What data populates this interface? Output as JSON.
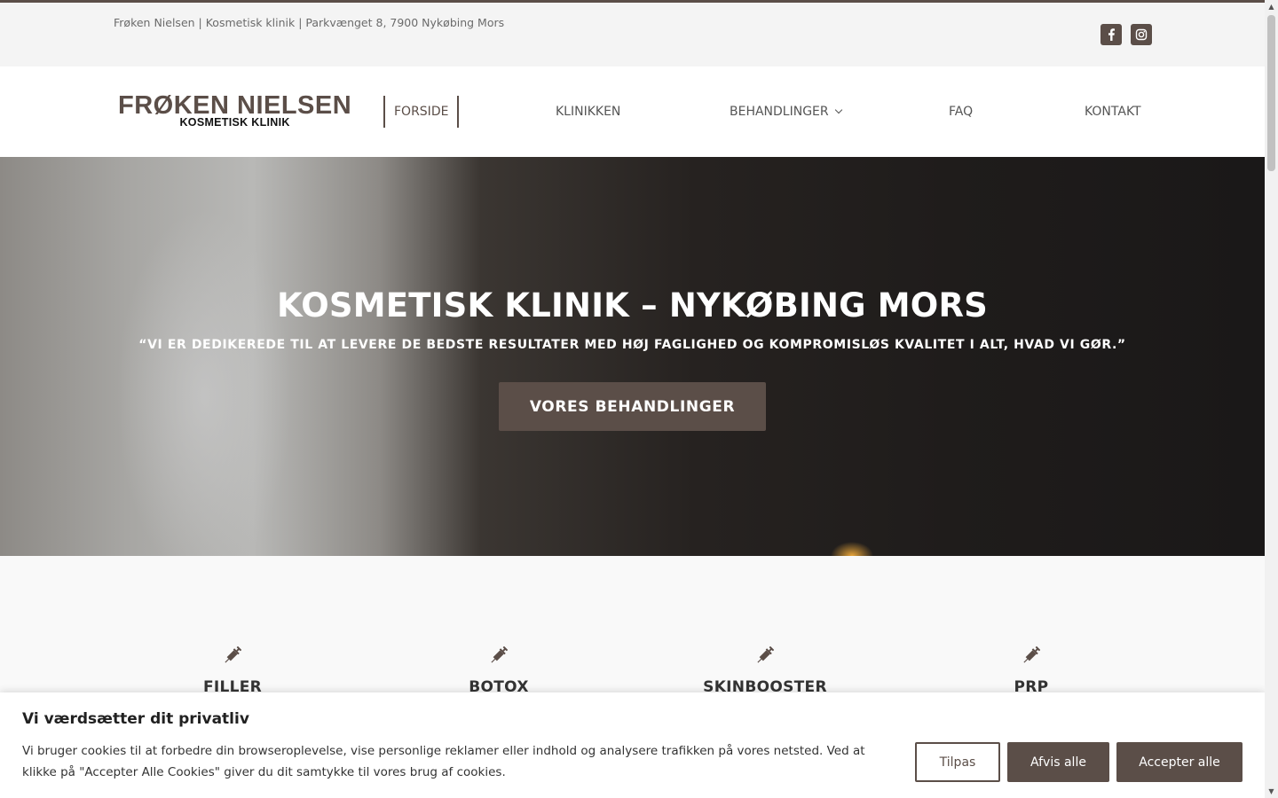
{
  "topbar": {
    "text": "Frøken Nielsen | Kosmetisk klinik | Parkvænget 8, 7900 Nykøbing Mors",
    "social": [
      {
        "name": "facebook-icon",
        "glyph": "f"
      },
      {
        "name": "instagram-icon",
        "glyph": "◎"
      }
    ]
  },
  "logo": {
    "main": "FRØKEN NIELSEN",
    "sub": "KOSMETISK KLINIK"
  },
  "nav": {
    "items": [
      {
        "label": "FORSIDE",
        "active": true
      },
      {
        "label": "KLINIKKEN"
      },
      {
        "label": "BEHANDLINGER",
        "dropdown": true
      },
      {
        "label": "FAQ"
      },
      {
        "label": "KONTAKT"
      }
    ]
  },
  "hero": {
    "title": "KOSMETISK KLINIK – NYKØBING MORS",
    "quote": "“VI ER DEDIKEREDE TIL AT LEVERE DE BEDSTE RESULTATER MED HØJ FAGLIGHED OG KOMPROMISLØS KVALITET I ALT, HVAD VI GØR.”",
    "button": "VORES BEHANDLINGER"
  },
  "treatments": [
    {
      "label": "FILLER",
      "icon": "syringe-icon"
    },
    {
      "label": "BOTOX",
      "icon": "syringe-icon"
    },
    {
      "label": "SKINBOOSTER",
      "icon": "syringe-icon"
    },
    {
      "label": "PRP",
      "icon": "syringe-icon"
    }
  ],
  "cookie": {
    "title": "Vi værdsætter dit privatliv",
    "text": "Vi bruger cookies til at forbedre din browseroplevelse, vise personlige reklamer eller indhold og analysere trafikken på vores netsted. Ved at klikke på \"Accepter Alle Cookies\" giver du dit samtykke til vores brug af cookies.",
    "buttons": {
      "customize": "Tilpas",
      "reject": "Afvis alle",
      "accept": "Accepter alle"
    }
  },
  "colors": {
    "brand": "#5b4e48",
    "header_bg": "#ffffff",
    "topbar_bg": "#f4f4f4"
  }
}
